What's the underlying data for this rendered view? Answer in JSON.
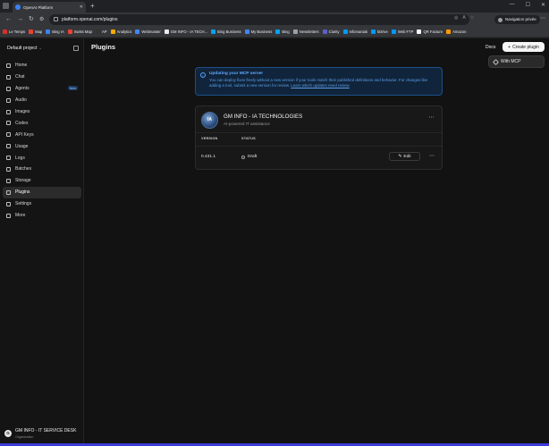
{
  "browser": {
    "tab_title": "OpenAI Platform",
    "url": "platform.openai.com/plugins",
    "private_label": "Navigation privée",
    "bookmarks": [
      {
        "label": "Le Temps",
        "color": "#d93025"
      },
      {
        "label": "Map",
        "color": "#e94235"
      },
      {
        "label": "Bing IA",
        "color": "#3b82f6"
      },
      {
        "label": "Swiss Map",
        "color": "#e94235"
      },
      {
        "label": "AP",
        "color": "#333333"
      },
      {
        "label": "Analytics",
        "color": "#f9ab00"
      },
      {
        "label": "Webmaster",
        "color": "#4285f4"
      },
      {
        "label": "GM INFO - IA TECH...",
        "color": "#e8eaed"
      },
      {
        "label": "Bing Business",
        "color": "#00a4ef"
      },
      {
        "label": "My Business",
        "color": "#4285f4"
      },
      {
        "label": "Bing",
        "color": "#00a4ef"
      },
      {
        "label": "Newsletters",
        "color": "#9aa0a6"
      },
      {
        "label": "Clarity",
        "color": "#5b5fc7"
      },
      {
        "label": "Infomaniak",
        "color": "#0098ff"
      },
      {
        "label": "kDrive",
        "color": "#0098ff"
      },
      {
        "label": "Web FTP",
        "color": "#0098ff"
      },
      {
        "label": "QR Facture",
        "color": "#f5f5f5"
      },
      {
        "label": "Amazon",
        "color": "#ff9900"
      }
    ]
  },
  "sidebar": {
    "project": "Default project",
    "items": [
      {
        "label": "Home",
        "icon": "home-icon",
        "active": false,
        "badge": ""
      },
      {
        "label": "Chat",
        "icon": "chat-icon",
        "active": false,
        "badge": ""
      },
      {
        "label": "Agents",
        "icon": "agents-icon",
        "active": false,
        "badge": "New"
      },
      {
        "label": "Audio",
        "icon": "audio-icon",
        "active": false,
        "badge": ""
      },
      {
        "label": "Images",
        "icon": "images-icon",
        "active": false,
        "badge": ""
      },
      {
        "label": "Codex",
        "icon": "codex-icon",
        "active": false,
        "badge": ""
      },
      {
        "label": "API Keys",
        "icon": "key-icon",
        "active": false,
        "badge": ""
      },
      {
        "label": "Usage",
        "icon": "usage-icon",
        "active": false,
        "badge": ""
      },
      {
        "label": "Logs",
        "icon": "logs-icon",
        "active": false,
        "badge": ""
      },
      {
        "label": "Batches",
        "icon": "batches-icon",
        "active": false,
        "badge": ""
      },
      {
        "label": "Storage",
        "icon": "storage-icon",
        "active": false,
        "badge": ""
      },
      {
        "label": "Plugins",
        "icon": "plugins-icon",
        "active": true,
        "badge": ""
      },
      {
        "label": "Settings",
        "icon": "gear-icon",
        "active": false,
        "badge": ""
      },
      {
        "label": "More",
        "icon": "more-icon",
        "active": false,
        "badge": ""
      }
    ],
    "org": {
      "avatar": "G",
      "name": "GM INFO - IT SERVICE DESK",
      "sub": "Organization"
    }
  },
  "main": {
    "title": "Plugins",
    "docs_label": "Docs",
    "create_label": "Create plugin",
    "dropdown_item": "With MCP",
    "banner": {
      "title": "Updating your MCP server",
      "body": "You can deploy fixes freely without a new version if your tools match their published definitions and behavior. For changes like adding a tool, submit a new version for review.",
      "link": "Learn which updates need review"
    },
    "plugin": {
      "logo_text": "IA",
      "name": "GM INFO - IA TECHNOLOGIES",
      "description": "AI-powered IT assistance",
      "col_version": "VERSION",
      "col_status": "STATUS",
      "version": "0.431.1",
      "status": "Draft",
      "edit_label": "Edit"
    }
  },
  "colors": {
    "accent": "#3b82f6",
    "banner_bg": "#10243b",
    "banner_text": "#62aaff"
  }
}
